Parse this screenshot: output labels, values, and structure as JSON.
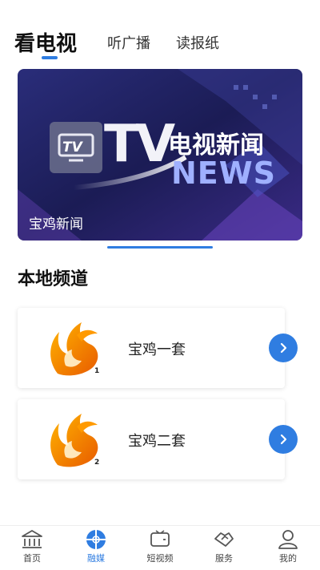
{
  "tabs": [
    {
      "label": "看电视",
      "active": true
    },
    {
      "label": "听广播",
      "active": false
    },
    {
      "label": "读报纸",
      "active": false
    }
  ],
  "banner": {
    "caption": "宝鸡新闻",
    "logo_text_tv": "TV",
    "logo_text_cn": "电视新闻",
    "logo_text_en": "NEWS"
  },
  "section": {
    "title": "本地频道"
  },
  "channels": [
    {
      "name": "宝鸡一套",
      "number": "1",
      "icon": "flame-logo-icon"
    },
    {
      "name": "宝鸡二套",
      "number": "2",
      "icon": "flame-logo-icon"
    }
  ],
  "bottom_nav": [
    {
      "label": "首页",
      "icon": "home-icon",
      "active": false
    },
    {
      "label": "融媒",
      "icon": "media-icon",
      "active": true
    },
    {
      "label": "短视频",
      "icon": "video-icon",
      "active": false
    },
    {
      "label": "服务",
      "icon": "handshake-icon",
      "active": false
    },
    {
      "label": "我的",
      "icon": "user-icon",
      "active": false
    }
  ],
  "colors": {
    "accent": "#2f7de1",
    "banner_bg": "#1c1f5a"
  }
}
